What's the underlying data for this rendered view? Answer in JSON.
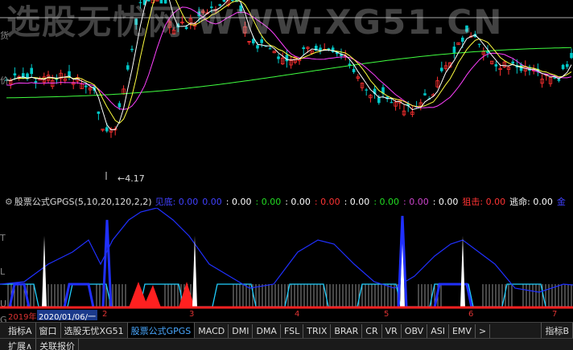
{
  "watermark": "选股无忧网 WWW.XG51.CN",
  "price_low_label": "←4.17",
  "left_axis_marks": [
    "货",
    "价",
    "T",
    "L",
    "U",
    "G"
  ],
  "indicator": {
    "settings_icon": "gear-icon",
    "name": "股票公式GPGS(5,10,20,120,2,2)",
    "items": [
      {
        "label": "见底:",
        "value": "0.00",
        "color": "#4040ff"
      },
      {
        "label": "",
        "value": "0.00",
        "color": "#4040ff"
      },
      {
        "label": ":",
        "value": "0.00",
        "color": "#ffffff"
      },
      {
        "label": ":",
        "value": "0.00",
        "color": "#22dd22"
      },
      {
        "label": ":",
        "value": "0.00",
        "color": "#ffffff"
      },
      {
        "label": ":",
        "value": "0.00",
        "color": "#ff3333"
      },
      {
        "label": ":",
        "value": "0.00",
        "color": "#ffffff"
      },
      {
        "label": ":",
        "value": "0.00",
        "color": "#22dd22"
      },
      {
        "label": ":",
        "value": "0.00",
        "color": "#cc44cc"
      },
      {
        "label": ":",
        "value": "0.00",
        "color": "#ffffff"
      },
      {
        "label": "狙击:",
        "value": "0.00",
        "color": "#ff3333"
      },
      {
        "label": "逃命:",
        "value": "0.00",
        "color": "#ffffff"
      },
      {
        "label": "金",
        "value": "",
        "color": "#4040ff"
      }
    ]
  },
  "date_bar": {
    "start": "2019年",
    "cursor_date": "2020/01/06/一",
    "months": [
      "2",
      "3",
      "4",
      "5",
      "6",
      "7"
    ]
  },
  "tabs": [
    "指标A",
    "窗口",
    "选股无忧XG51",
    "股票公式GPGS",
    "MACD",
    "DMI",
    "DMA",
    "FSL",
    "TRIX",
    "BRAR",
    "CR",
    "VR",
    "OBV",
    "ASI",
    "EMV",
    ">",
    "指标B"
  ],
  "active_tab": "股票公式GPGS",
  "bottom_tabs": [
    "扩展∧",
    "关联报价"
  ],
  "colors": {
    "up": "#ff3030",
    "down": "#00c8c8",
    "ma5": "#ffffff",
    "ma10": "#ffff40",
    "ma20": "#ff40ff",
    "ma120": "#40ff40",
    "sub_blue": "#2030ff",
    "sub_cyan": "#20d0ff",
    "bottom_signal": "#ff2020"
  }
}
